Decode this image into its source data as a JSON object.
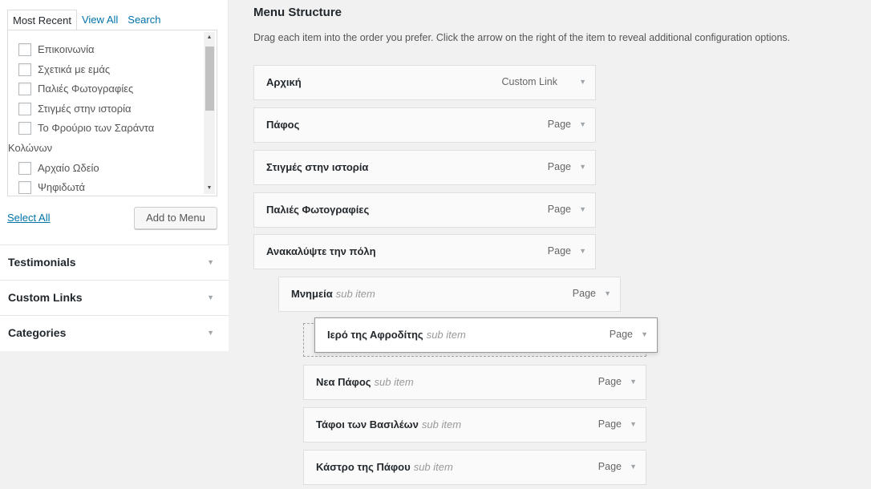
{
  "left": {
    "tabs": [
      "Most Recent",
      "View All",
      "Search"
    ],
    "pages": [
      "Επικοινωνία",
      "Σχετικά με εμάς",
      "Παλιές Φωτογραφίες",
      "Στιγμές στην ιστορία",
      "Το Φρούριο των Σαράντα",
      "Αρχαίο Ωδείο",
      "Ψηφιδωτά"
    ],
    "page_wrap": "Κολώνων",
    "select_all": "Select All",
    "add_to_menu": "Add to Menu",
    "sections": [
      "Testimonials",
      "Custom Links",
      "Categories"
    ]
  },
  "menu": {
    "title": "Menu Structure",
    "description": "Drag each item into the order you prefer. Click the arrow on the right of the item to reveal additional configuration options.",
    "sub_item_label": "sub item",
    "items": [
      {
        "title": "Αρχική",
        "type": "Custom Link"
      },
      {
        "title": "Πάφος",
        "type": "Page"
      },
      {
        "title": "Στιγμές στην ιστορία",
        "type": "Page"
      },
      {
        "title": "Παλιές Φωτογραφίες",
        "type": "Page"
      },
      {
        "title": "Ανακαλύψτε την πόλη",
        "type": "Page"
      },
      {
        "title": "Μνημεία",
        "type": "Page"
      },
      {
        "title": "Ιερό της Αφροδίτης",
        "type": "Page"
      },
      {
        "title": "Νεα Πάφος",
        "type": "Page"
      },
      {
        "title": "Τάφοι των Βασιλέων",
        "type": "Page"
      },
      {
        "title": "Κάστρο της Πάφου",
        "type": "Page"
      }
    ]
  }
}
